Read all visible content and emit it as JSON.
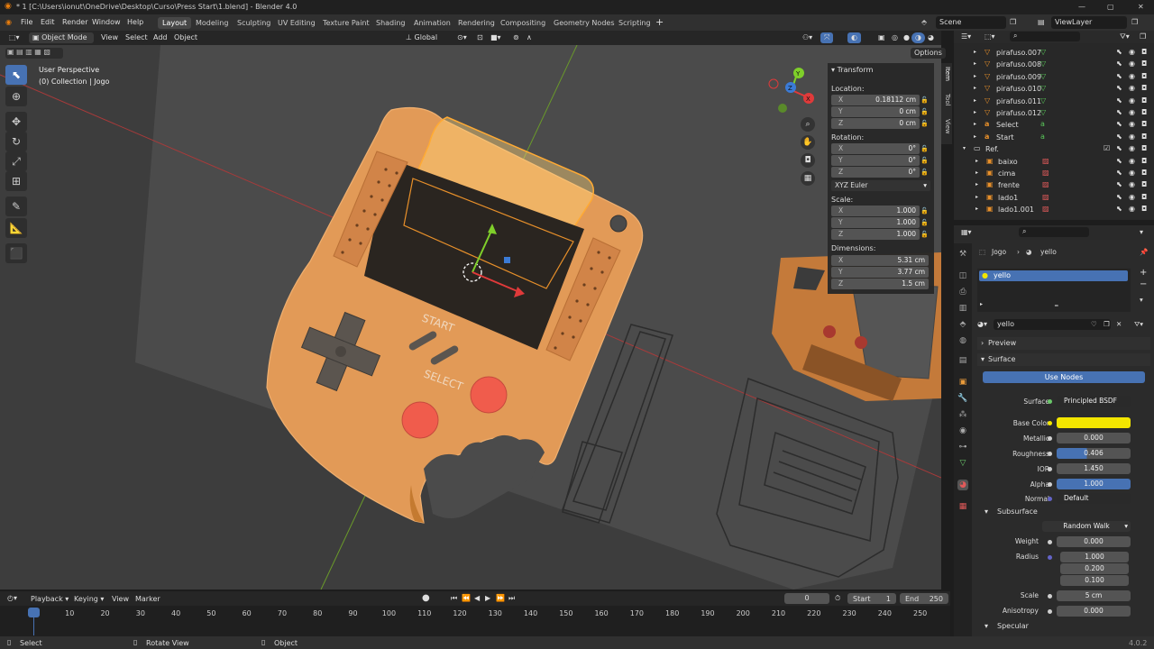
{
  "titlebar": {
    "title": "* 1 [C:\\Users\\ionut\\OneDrive\\Desktop\\Curso\\Press Start\\1.blend] - Blender 4.0"
  },
  "menu": [
    "File",
    "Edit",
    "Render",
    "Window",
    "Help"
  ],
  "workspaces": [
    "Layout",
    "Modeling",
    "Sculpting",
    "UV Editing",
    "Texture Paint",
    "Shading",
    "Animation",
    "Rendering",
    "Compositing",
    "Geometry Nodes",
    "Scripting"
  ],
  "scene": "Scene",
  "view_layer": "ViewLayer",
  "viewport_header": {
    "mode": "Object Mode",
    "items": [
      "View",
      "Select",
      "Add",
      "Object"
    ],
    "orientation": "Global",
    "options": "Options"
  },
  "viewport": {
    "perspective": "User Perspective",
    "collection": "(0) Collection | Jogo",
    "start_label": "START",
    "select_label": "SELECT"
  },
  "n_panel": {
    "tabs": [
      "Item",
      "Tool",
      "View"
    ],
    "title": "Transform",
    "location_label": "Location:",
    "location": [
      {
        "k": "X",
        "v": "0.18112 cm"
      },
      {
        "k": "Y",
        "v": "0 cm"
      },
      {
        "k": "Z",
        "v": "0 cm"
      }
    ],
    "rotation_label": "Rotation:",
    "rotation": [
      {
        "k": "X",
        "v": "0°"
      },
      {
        "k": "Y",
        "v": "0°"
      },
      {
        "k": "Z",
        "v": "0°"
      }
    ],
    "rotation_mode": "XYZ Euler",
    "scale_label": "Scale:",
    "scale": [
      {
        "k": "X",
        "v": "1.000"
      },
      {
        "k": "Y",
        "v": "1.000"
      },
      {
        "k": "Z",
        "v": "1.000"
      }
    ],
    "dimensions_label": "Dimensions:",
    "dimensions": [
      {
        "k": "X",
        "v": "5.31 cm"
      },
      {
        "k": "Y",
        "v": "3.77 cm"
      },
      {
        "k": "Z",
        "v": "1.5 cm"
      }
    ]
  },
  "outliner": {
    "rows": [
      {
        "name": "pirafuso.007"
      },
      {
        "name": "pirafuso.008"
      },
      {
        "name": "pirafuso.009"
      },
      {
        "name": "pirafuso.010"
      },
      {
        "name": "pirafuso.011"
      },
      {
        "name": "pirafuso.012"
      },
      {
        "name": "Select"
      },
      {
        "name": "Start"
      },
      {
        "name": "Ref."
      },
      {
        "name": "baixo"
      },
      {
        "name": "cima"
      },
      {
        "name": "frente"
      },
      {
        "name": "lado1"
      },
      {
        "name": "lado1.001"
      }
    ]
  },
  "properties": {
    "breadcrumb_object": "Jogo",
    "breadcrumb_material": "yello",
    "slot": "yello",
    "material_name": "yello",
    "preview": "Preview",
    "surface_section": "Surface",
    "use_nodes": "Use Nodes",
    "rows": [
      {
        "label": "Surface",
        "value": "Principled BSDF"
      },
      {
        "label": "Base Color",
        "value": ""
      },
      {
        "label": "Metallic",
        "value": "0.000"
      },
      {
        "label": "Roughness",
        "value": "0.406"
      },
      {
        "label": "IOR",
        "value": "1.450"
      },
      {
        "label": "Alpha",
        "value": "1.000"
      },
      {
        "label": "Normal",
        "value": "Default"
      }
    ],
    "subsurface": "Subsurface",
    "sss_method": "Random Walk",
    "weight_label": "Weight",
    "weight": "0.000",
    "radius_label": "Radius",
    "radius": [
      "1.000",
      "0.200",
      "0.100"
    ],
    "scale_label": "Scale",
    "scale": "5 cm",
    "anisotropy_label": "Anisotropy",
    "anisotropy": "0.000",
    "specular": "Specular",
    "colors": {
      "base_color": "#f3e600",
      "accent": "#4772b3"
    }
  },
  "timeline": {
    "items": [
      "Playback",
      "Keying",
      "View",
      "Marker"
    ],
    "current": "0",
    "start_label": "Start",
    "start": "1",
    "end_label": "End",
    "end": "250",
    "ticks": [
      "0",
      "10",
      "20",
      "30",
      "40",
      "50",
      "60",
      "70",
      "80",
      "90",
      "100",
      "110",
      "120",
      "130",
      "140",
      "150",
      "160",
      "170",
      "180",
      "190",
      "200",
      "210",
      "220",
      "230",
      "240",
      "250"
    ]
  },
  "status": {
    "select": "Select",
    "rotate": "Rotate View",
    "object": "Object",
    "version": "4.0.2"
  }
}
